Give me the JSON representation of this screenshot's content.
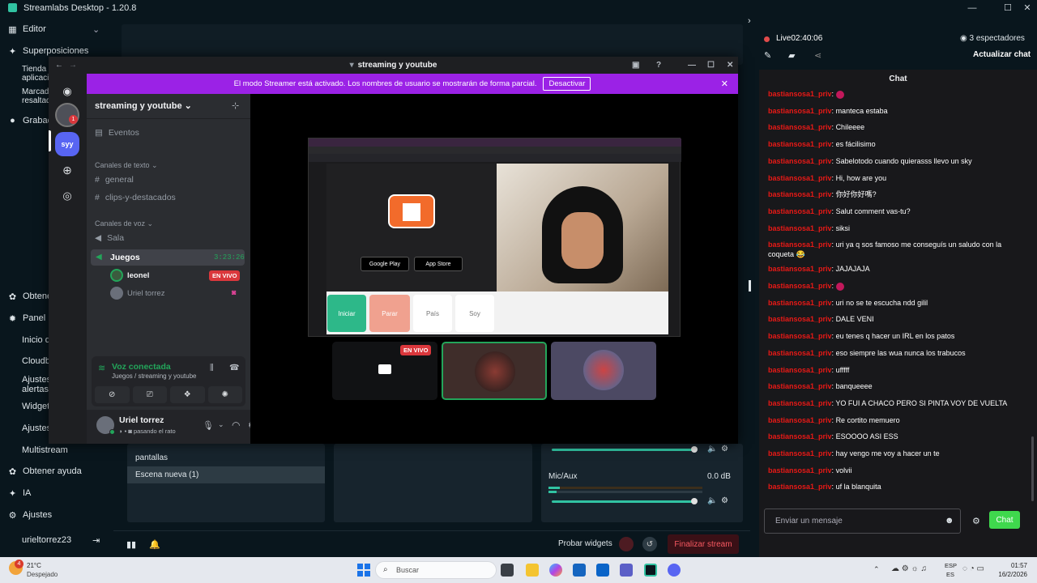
{
  "app": {
    "title": "Streamlabs Desktop - 1.20.8"
  },
  "sidebar": {
    "editor": "Editor",
    "overlays": "Superposiciones",
    "app_store_1": "Tienda de",
    "app_store_2": "aplicació",
    "highlights_1": "Marcado",
    "highlights_2": "resaltad",
    "recordings": "Grabació",
    "obtain": "Obtener",
    "panel": "Panel",
    "dashboard_home": "Inicio de",
    "cloudbot": "Cloudbo",
    "alert_settings_1": "Ajustes",
    "alert_settings_2": "alertas",
    "widgets": "Widgets",
    "settings_sub": "Ajustes",
    "multistream": "Multistream",
    "get_help": "Obtener ayuda",
    "ai": "IA",
    "settings": "Ajustes",
    "username": "urieltorrez23"
  },
  "scenes": {
    "item1": "pantallas",
    "item2": "Escena nueva (1)"
  },
  "mixer": {
    "label": "Mic/Aux",
    "value": "0.0 dB"
  },
  "footer": {
    "test_widgets": "Probar widgets",
    "end_stream": "Finalizar stream"
  },
  "discord": {
    "window_title": "streaming y youtube",
    "banner_text": "El modo Streamer está activado. Los nombres de usuario se mostrarán de forma parcial.",
    "banner_button": "Desactivar",
    "server_name": "streaming y youtube",
    "server_badge": "syy",
    "avatar_badge": "1",
    "events": "Eventos",
    "text_category": "Canales de texto",
    "text_channels": [
      "general",
      "clips-y-destacados"
    ],
    "voice_category": "Canales de voz",
    "voice_room": "Sala",
    "voice_active": "Juegos",
    "voice_time": "3:23:26",
    "voice_users": [
      {
        "name": "leonel",
        "badge": "EN VIVO"
      },
      {
        "name": "Uriel torrez"
      }
    ],
    "voice_connected": "Voz conectada",
    "voice_path": "Juegos / streaming y youtube",
    "user_name": "Uriel torrez",
    "user_status": "pasando el rato",
    "live_tag": "EN VIVO",
    "inner": {
      "iniciar": "Iniciar",
      "parar": "Parar",
      "pais": "País",
      "soy": "Soy",
      "google_play": "Google Play",
      "app_store": "App Store"
    }
  },
  "chat": {
    "live_label": "Live",
    "live_time": "02:40:06",
    "viewers": "3 espectadores",
    "refresh": "Actualizar chat",
    "header": "Chat",
    "username": "bastiansosa1_priv",
    "messages": [
      {
        "text": ""
      },
      {
        "text": "manteca estaba"
      },
      {
        "text": "Chileeee"
      },
      {
        "text": "es fácilisimo"
      },
      {
        "text": "Sabelotodo cuando quierasss llevo un sky"
      },
      {
        "text": "Hi, how are you"
      },
      {
        "text": "你好你好嗎?"
      },
      {
        "text": "Salut comment vas-tu?"
      },
      {
        "text": "siksi"
      },
      {
        "text": "uri ya q sos famoso me conseguís un saludo con la coqueta 😂"
      },
      {
        "text": "JAJAJAJA"
      },
      {
        "text": ""
      },
      {
        "text": "uri no se te escucha ndd gilil"
      },
      {
        "text": "DALE VENI"
      },
      {
        "text": "eu tenes q hacer un IRL en los patos"
      },
      {
        "text": "eso siempre las wua nunca los trabucos"
      },
      {
        "text": "ufffff"
      },
      {
        "text": "banqueeee"
      },
      {
        "text": "YO FUI A CHACO PERO SI PINTA VOY DE VUELTA"
      },
      {
        "text": "Re cortito memuero"
      },
      {
        "text": "ESOOOO ASI ESS"
      },
      {
        "text": "hay vengo me voy a hacer un te"
      },
      {
        "text": "volvii"
      },
      {
        "text": "uf la blanquita"
      }
    ],
    "input_placeholder": "Enviar un mensaje",
    "send_button": "Chat"
  },
  "taskbar": {
    "temperature": "21°C",
    "weather": "Despejado",
    "weather_badge": "4",
    "search": "Buscar",
    "lang1": "ESP",
    "lang2": "ES",
    "time": "01:57",
    "date": "16/2/2026"
  }
}
